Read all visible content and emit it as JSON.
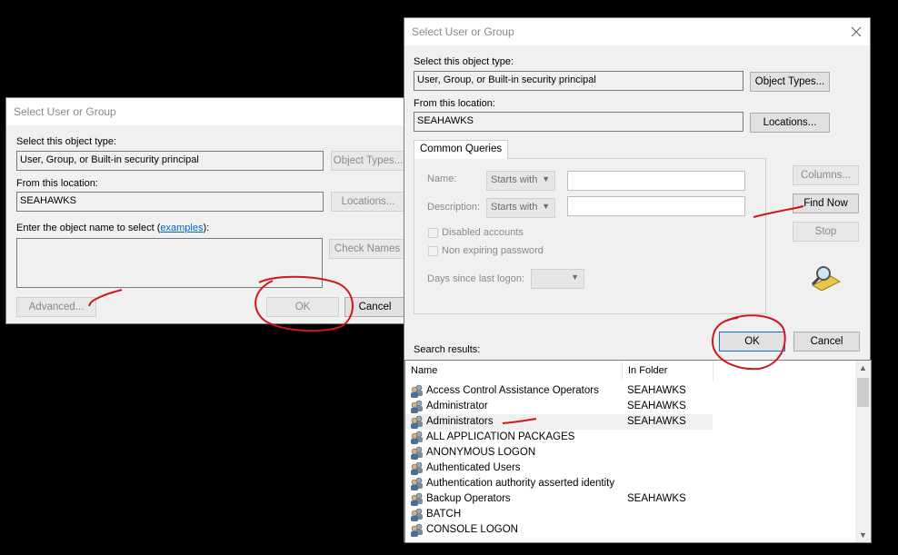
{
  "left_dialog": {
    "title": "Select User or Group",
    "object_type_label": "Select this object type:",
    "object_type_value": "User, Group, or Built-in security principal",
    "object_types_button": "Object Types...",
    "location_label": "From this location:",
    "location_value": "SEAHAWKS",
    "locations_button": "Locations...",
    "enter_name_label_pre": "Enter the object name to select (",
    "examples_link": "examples",
    "enter_name_label_post": "):",
    "check_names_button": "Check Names",
    "advanced_button": "Advanced...",
    "ok_button": "OK",
    "cancel_button": "Cancel"
  },
  "right_dialog": {
    "title": "Select User or Group",
    "close_icon": "close-icon",
    "object_type_label": "Select this object type:",
    "object_type_value": "User, Group, or Built-in security principal",
    "object_types_button": "Object Types...",
    "location_label": "From this location:",
    "location_value": "SEAHAWKS",
    "locations_button": "Locations...",
    "common_queries_tab": "Common Queries",
    "name_label": "Name:",
    "name_mode": "Starts with",
    "description_label": "Description:",
    "description_mode": "Starts with",
    "disabled_accounts": "Disabled accounts",
    "non_expiring_password": "Non expiring password",
    "days_since_logon": "Days since last logon:",
    "columns_button": "Columns...",
    "find_now_button": "Find Now",
    "stop_button": "Stop",
    "ok_button": "OK",
    "cancel_button": "Cancel",
    "search_results_label": "Search results:",
    "columns": [
      "Name",
      "In Folder"
    ],
    "results": [
      {
        "name": "Access Control Assistance Operators",
        "folder": "SEAHAWKS"
      },
      {
        "name": "Administrator",
        "folder": "SEAHAWKS"
      },
      {
        "name": "Administrators",
        "folder": "SEAHAWKS"
      },
      {
        "name": "ALL APPLICATION PACKAGES",
        "folder": ""
      },
      {
        "name": "ANONYMOUS LOGON",
        "folder": ""
      },
      {
        "name": "Authenticated Users",
        "folder": ""
      },
      {
        "name": "Authentication authority asserted identity",
        "folder": ""
      },
      {
        "name": "Backup Operators",
        "folder": "SEAHAWKS"
      },
      {
        "name": "BATCH",
        "folder": ""
      },
      {
        "name": "CONSOLE LOGON",
        "folder": ""
      }
    ],
    "selected_row": 2
  },
  "annotation_color": "#d0161c"
}
